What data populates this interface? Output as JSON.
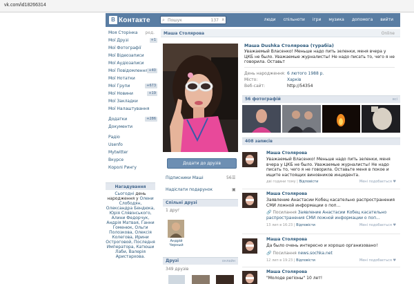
{
  "browser": {
    "url": "vk.com/id18266314"
  },
  "header": {
    "logo_letter": "В",
    "logo_text": "Контакте",
    "search_placeholder": "Пошук",
    "search_count": "137",
    "search_clear": "х",
    "nav": [
      "люди",
      "спільноти",
      "ігри",
      "музика",
      "допомога",
      "вийти"
    ]
  },
  "sidebar": {
    "items": [
      {
        "label": "Моя Сторінка",
        "extra": "ред."
      },
      {
        "label": "Мої Друзі",
        "count": "+1"
      },
      {
        "label": "Мої Фотографії"
      },
      {
        "label": "Мої Відеозаписи"
      },
      {
        "label": "Мої Аудіозаписи"
      },
      {
        "label": "Мої Повідомлення",
        "count": "+40"
      },
      {
        "label": "Мої Нотатки"
      },
      {
        "label": "Мої Групи",
        "count": "+673"
      },
      {
        "label": "Мої Новини",
        "count": "+19"
      },
      {
        "label": "Мої Закладки"
      },
      {
        "label": "Мої Налаштування"
      }
    ],
    "items2": [
      {
        "label": "Додатки",
        "count": "+286"
      },
      {
        "label": "Документи"
      }
    ],
    "items3": [
      {
        "label": "Радіо"
      },
      {
        "label": "Usenfo"
      },
      {
        "label": "Mytwitter"
      },
      {
        "label": "Вкурсе"
      },
      {
        "label": "Королі Рингу"
      }
    ]
  },
  "reminder": {
    "title": "Нагадування",
    "today": "Сьогодні",
    "text_black": "день народження у",
    "names": "Олени Слободян, Олександра Бендюка, Юрія Слявінського, Алини Федорчук, Андрія Матвая, Ганни Гоменюк, Ольги Полозкова, Олексія Колегова, Ирини Остроговой, Последня Императора, Катюши Лаби, Валерія Аристархова."
  },
  "profile": {
    "page_name": "Маша Столярова",
    "online": "Online",
    "full_name": "Маша Dushka Столярова (турабіа)",
    "status": "Уважаемый Власенко! Меньше надо пить зеленки, меня вчера у ЦКБ не было. Уважаемые журналисты! Не надо писать то, чего я не говорила. Оставьт",
    "birthday_label": "День народження:",
    "birthday_value": "6 лютого 1988 р.",
    "city_label": "Місто:",
    "city_value": "Харків",
    "website_label": "Веб-сайт:",
    "website_value": "http://54354",
    "add_friend": "Додати до друзів",
    "subscribers_label": "Підписники Маші",
    "subscribers_count": "56",
    "send_gift": "Надіслати подарунок",
    "common_friends_title": "Спільні друзі",
    "common_friends_count": "1 друг",
    "friend_name": "Андрій Черный",
    "friends_title": "Друзі",
    "friends_all": "онлайн",
    "friends_count": "349 друзів",
    "photos_title": "56 фотографій",
    "photos_all": "всі",
    "posts_title": "408 записів"
  },
  "posts": [
    {
      "author": "Маша Столярова",
      "text": "Уважаемый Власенко! Меньше надо пить зеленки, меня вчера у ЦКБ не было. Уважаемые журналисты! Не надо писать то, чего я не говорила. Оставьте меня в покое и ищите настоящих виновников инцидента.",
      "meta": "дві години тому",
      "reply": "Відповісти",
      "like": "Мені подобається"
    },
    {
      "author": "Маша Столярова",
      "text": "Заявление Анастасии Кобец касательно распространения СМИ ложной информации о поп...",
      "attach_label": "Посилання",
      "attach_link": "Заявление Анастасии Кобец касательно распространения СМИ ложной информации о поп...",
      "meta": "13 лип в 16:23",
      "reply": "Відповісти",
      "like": "Мені подобається"
    },
    {
      "author": "Маша Столярова",
      "text": "Да было очень интересно и хорошо организовано!",
      "attach_label": "Посилання",
      "attach_link": "news.sochka.net",
      "meta": "12 лип в 19:23",
      "reply": "Відповісти",
      "like": "Мені подобається"
    },
    {
      "author": "Маша Столярова",
      "text": "\"Молоде регіоны\" 10 лет!"
    }
  ],
  "colors": {
    "header_blue": "#597da3",
    "link": "#2b587a",
    "section_bg": "#e3e8ef",
    "button": "#6d8fb3"
  }
}
